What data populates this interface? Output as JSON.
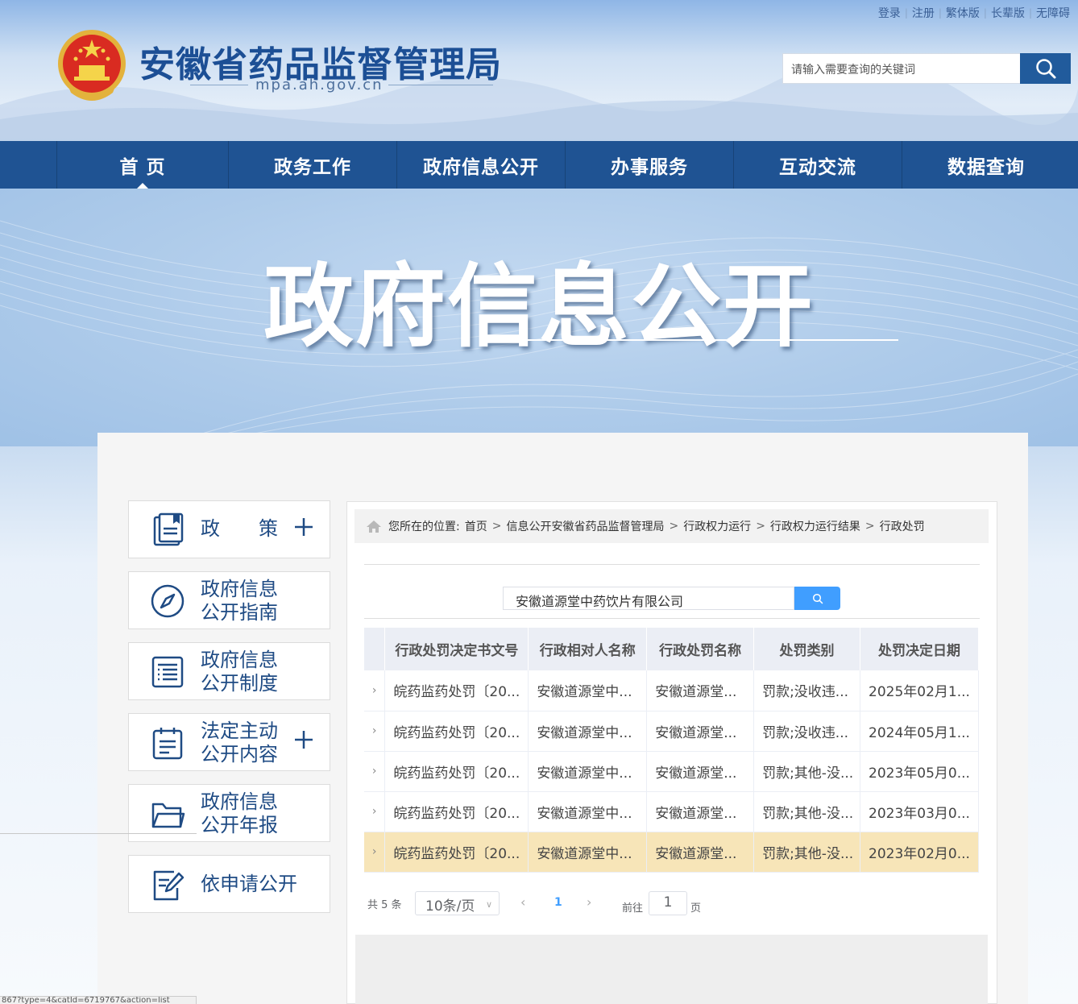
{
  "top_links": [
    "登录",
    "注册",
    "繁体版",
    "长辈版",
    "无障碍"
  ],
  "site": {
    "title": "安徽省药品监督管理局",
    "domain": "mpa.ah.gov.cn"
  },
  "search": {
    "placeholder": "请输入需要查询的关键词",
    "icon": "search-icon"
  },
  "nav": [
    "首 页",
    "政务工作",
    "政府信息公开",
    "办事服务",
    "互动交流",
    "数据查询"
  ],
  "nav_active": "首 页",
  "banner": {
    "title": "政府信息公开"
  },
  "sidebar": [
    {
      "label_line1": "政　　策",
      "label_line2": "",
      "icon": "policy-icon",
      "expandable": true
    },
    {
      "label_line1": "政府信息",
      "label_line2": "公开指南",
      "icon": "compass-icon",
      "expandable": false
    },
    {
      "label_line1": "政府信息",
      "label_line2": "公开制度",
      "icon": "list-icon",
      "expandable": false
    },
    {
      "label_line1": "法定主动",
      "label_line2": "公开内容",
      "icon": "clipboard-icon",
      "expandable": true
    },
    {
      "label_line1": "政府信息",
      "label_line2": "公开年报",
      "icon": "folder-icon",
      "expandable": false
    },
    {
      "label_line1": "依申请公开",
      "label_line2": "",
      "icon": "edit-form-icon",
      "expandable": false
    }
  ],
  "breadcrumb": {
    "prefix": "您所在的位置:",
    "items": [
      "首页",
      "信息公开安徽省药品监督管理局",
      "行政权力运行",
      "行政权力运行结果",
      "行政处罚"
    ]
  },
  "query": {
    "value": "安徽道源堂中药饮片有限公司"
  },
  "table": {
    "headers": [
      "行政处罚决定书文号",
      "行政相对人名称",
      "行政处罚名称",
      "处罚类别",
      "处罚决定日期"
    ],
    "rows": [
      [
        "皖药监药处罚〔20...",
        "安徽道源堂中...",
        "安徽道源堂...",
        "罚款;没收违...",
        "2025年02月1..."
      ],
      [
        "皖药监药处罚〔20...",
        "安徽道源堂中...",
        "安徽道源堂...",
        "罚款;没收违...",
        "2024年05月1..."
      ],
      [
        "皖药监药处罚〔20...",
        "安徽道源堂中...",
        "安徽道源堂...",
        "罚款;其他-没...",
        "2023年05月0..."
      ],
      [
        "皖药监药处罚〔20...",
        "安徽道源堂中...",
        "安徽道源堂...",
        "罚款;其他-没...",
        "2023年03月0..."
      ],
      [
        "皖药监药处罚〔20...",
        "安徽道源堂中...",
        "安徽道源堂...",
        "罚款;其他-没...",
        "2023年02月0..."
      ]
    ],
    "highlighted_row": 4
  },
  "pagination": {
    "total": "共 5 条",
    "page_size": "10条/页",
    "current_page": "1",
    "goto_label": "前往",
    "goto_value": "1",
    "page_suffix": "页"
  },
  "status_url": "867?type=4&catId=6719767&action=list",
  "colors": {
    "nav_bg": "#1f5393",
    "title_blue": "#1c4f95",
    "accent": "#409eff",
    "highlight": "#f7e5b8"
  }
}
